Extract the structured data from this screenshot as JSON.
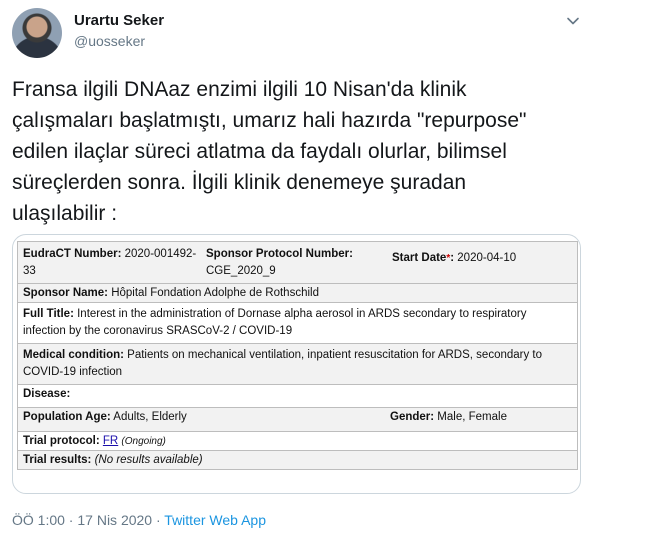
{
  "author": {
    "name": "Urartu Seker",
    "handle": "@uosseker"
  },
  "tweet": {
    "text": "Fransa ilgili DNAaz enzimi ilgili 10 Nisan'da klinik\nçalışmaları başlatmıştı, umarız hali hazırda \"repurpose\"\nedilen ilaçlar süreci atlatma da faydalı olurlar, bilimsel\nsüreçlerden sonra. İlgili klinik denemeye şuradan\nulaşılabilir :"
  },
  "trial": {
    "eudract_label": "EudraCT Number:",
    "eudract_value": "2020-001492-33",
    "sponsor_protocol_label": "Sponsor Protocol Number:",
    "sponsor_protocol_value": "CGE_2020_9",
    "start_date_label": "Start Date",
    "start_date_mark": "*",
    "start_date_value": "2020-04-10",
    "sponsor_name_label": "Sponsor Name:",
    "sponsor_name_value": "Hôpital Fondation Adolphe de Rothschild",
    "full_title_label": "Full Title:",
    "full_title_value": "Interest in the administration of Dornase alpha aerosol in ARDS secondary to respiratory infection by the coronavirus SRASCoV-2 / COVID-19",
    "medical_condition_label": "Medical condition:",
    "medical_condition_value": "Patients on mechanical ventilation, inpatient resuscitation for ARDS, secondary to COVID-19 infection",
    "disease_label": "Disease:",
    "population_age_label": "Population Age:",
    "population_age_value": "Adults, Elderly",
    "gender_label": "Gender:",
    "gender_value": "Male, Female",
    "trial_protocol_label": "Trial protocol:",
    "trial_protocol_link": "FR",
    "trial_protocol_status": "(Ongoing)",
    "trial_results_label": "Trial results:",
    "trial_results_value": "(No results available)"
  },
  "footer": {
    "time": "ÖÖ 1:00",
    "sep1": " · ",
    "date": "17 Nis 2020",
    "sep2": " · ",
    "source": "Twitter Web App"
  },
  "icons": {
    "menu": "chevron-down-icon"
  }
}
